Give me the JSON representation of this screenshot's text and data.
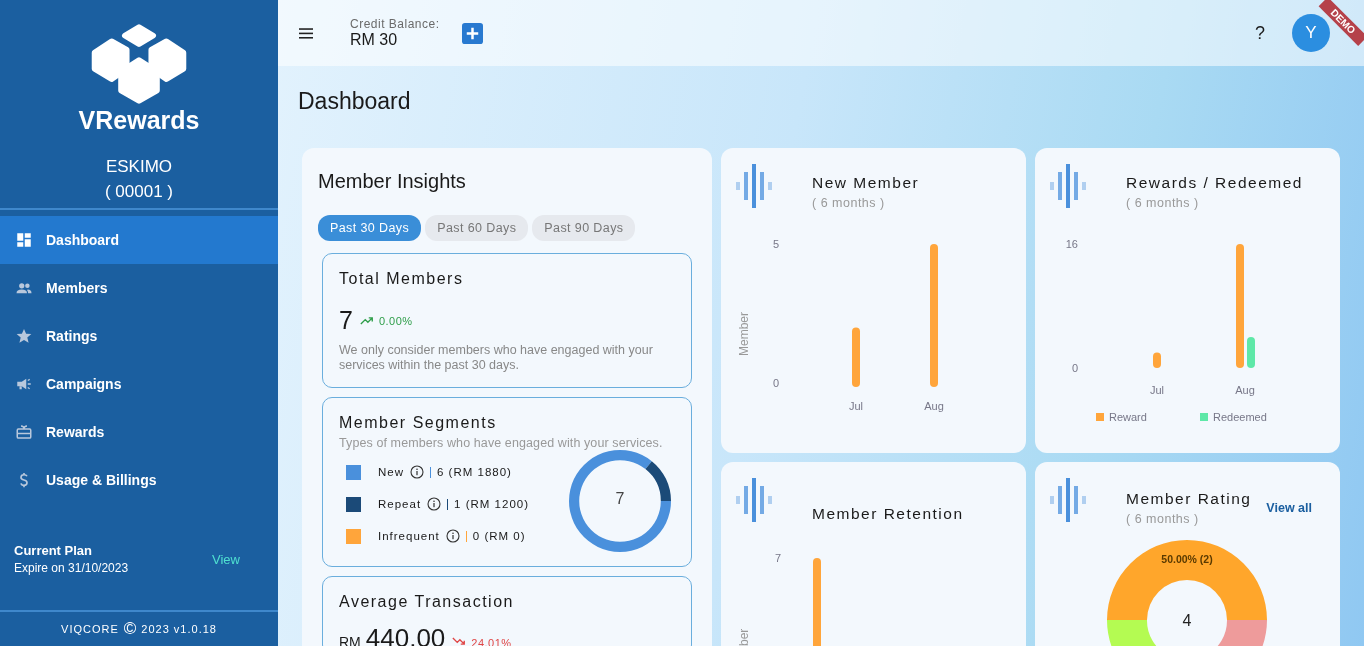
{
  "sidebar": {
    "logo_text": "VRewards",
    "company": "ESKIMO",
    "company_code": "( 00001 )",
    "items": [
      {
        "label": "Dashboard",
        "selected": true
      },
      {
        "label": "Members",
        "selected": false
      },
      {
        "label": "Ratings",
        "selected": false
      },
      {
        "label": "Campaigns",
        "selected": false
      },
      {
        "label": "Rewards",
        "selected": false
      },
      {
        "label": "Usage & Billings",
        "selected": false
      }
    ],
    "plan": {
      "title": "Current Plan",
      "expiry": "Expire on 31/10/2023",
      "link": "View"
    },
    "footer": {
      "brand": "VIQCORE",
      "copyright": "©",
      "text": "2023 v1.0.18"
    }
  },
  "header": {
    "credit_label": "Credit Balance:",
    "credit_value": "RM 30",
    "help": "?",
    "avatar": "Y",
    "ribbon": "DEMO"
  },
  "page_title": "Dashboard",
  "insights": {
    "title": "Member Insights",
    "tabs": [
      {
        "label": "Past 30 Days",
        "selected": true
      },
      {
        "label": "Past 60 Days",
        "selected": false
      },
      {
        "label": "Past 90 Days",
        "selected": false
      }
    ],
    "total": {
      "title": "Total Members",
      "value": "7",
      "trend": "0.00%",
      "trend_up": true,
      "note": "We only consider members who have engaged with your services within the past 30 days."
    },
    "segments": {
      "title": "Member Segments",
      "subtitle": "Types of members who have engaged with your services.",
      "items": [
        {
          "label": "New",
          "value": "6 (RM 1880)",
          "color": "#4a90dc"
        },
        {
          "label": "Repeat",
          "value": "1 (RM 1200)",
          "color": "#1b4a78"
        },
        {
          "label": "Infrequent",
          "value": "0 (RM 0)",
          "color": "#ffa53b"
        }
      ],
      "center": "7"
    },
    "average": {
      "title": "Average Transaction",
      "currency": "RM",
      "value": "440.00",
      "trend": "24.01%",
      "trend_up": false
    }
  },
  "new_member": {
    "title": "New Member",
    "subtitle": "( 6 months )",
    "chart_data": {
      "type": "bar",
      "ylabel": "Member",
      "categories": [
        "Jul",
        "Aug"
      ],
      "values": [
        2,
        5
      ],
      "ylim": [
        0,
        5
      ],
      "yticks": [
        0,
        5
      ]
    }
  },
  "rewards": {
    "title": "Rewards / Redeemed",
    "subtitle": "( 6 months )",
    "chart_data": {
      "type": "bar",
      "categories": [
        "Jul",
        "Aug"
      ],
      "series": [
        {
          "name": "Reward",
          "color": "#ffa53b",
          "values": [
            2,
            16
          ]
        },
        {
          "name": "Redeemed",
          "color": "#5ee8a8",
          "values": [
            0,
            4
          ]
        }
      ],
      "ylim": [
        0,
        16
      ],
      "yticks": [
        0,
        16
      ],
      "legend": "bottom"
    }
  },
  "retention": {
    "title": "Member Retention",
    "y_tick": "7",
    "y_label": "ber"
  },
  "rating": {
    "title": "Member Rating",
    "subtitle": "( 6 months )",
    "link": "View all",
    "slice_label": "50.00% (2)",
    "center": "4"
  }
}
